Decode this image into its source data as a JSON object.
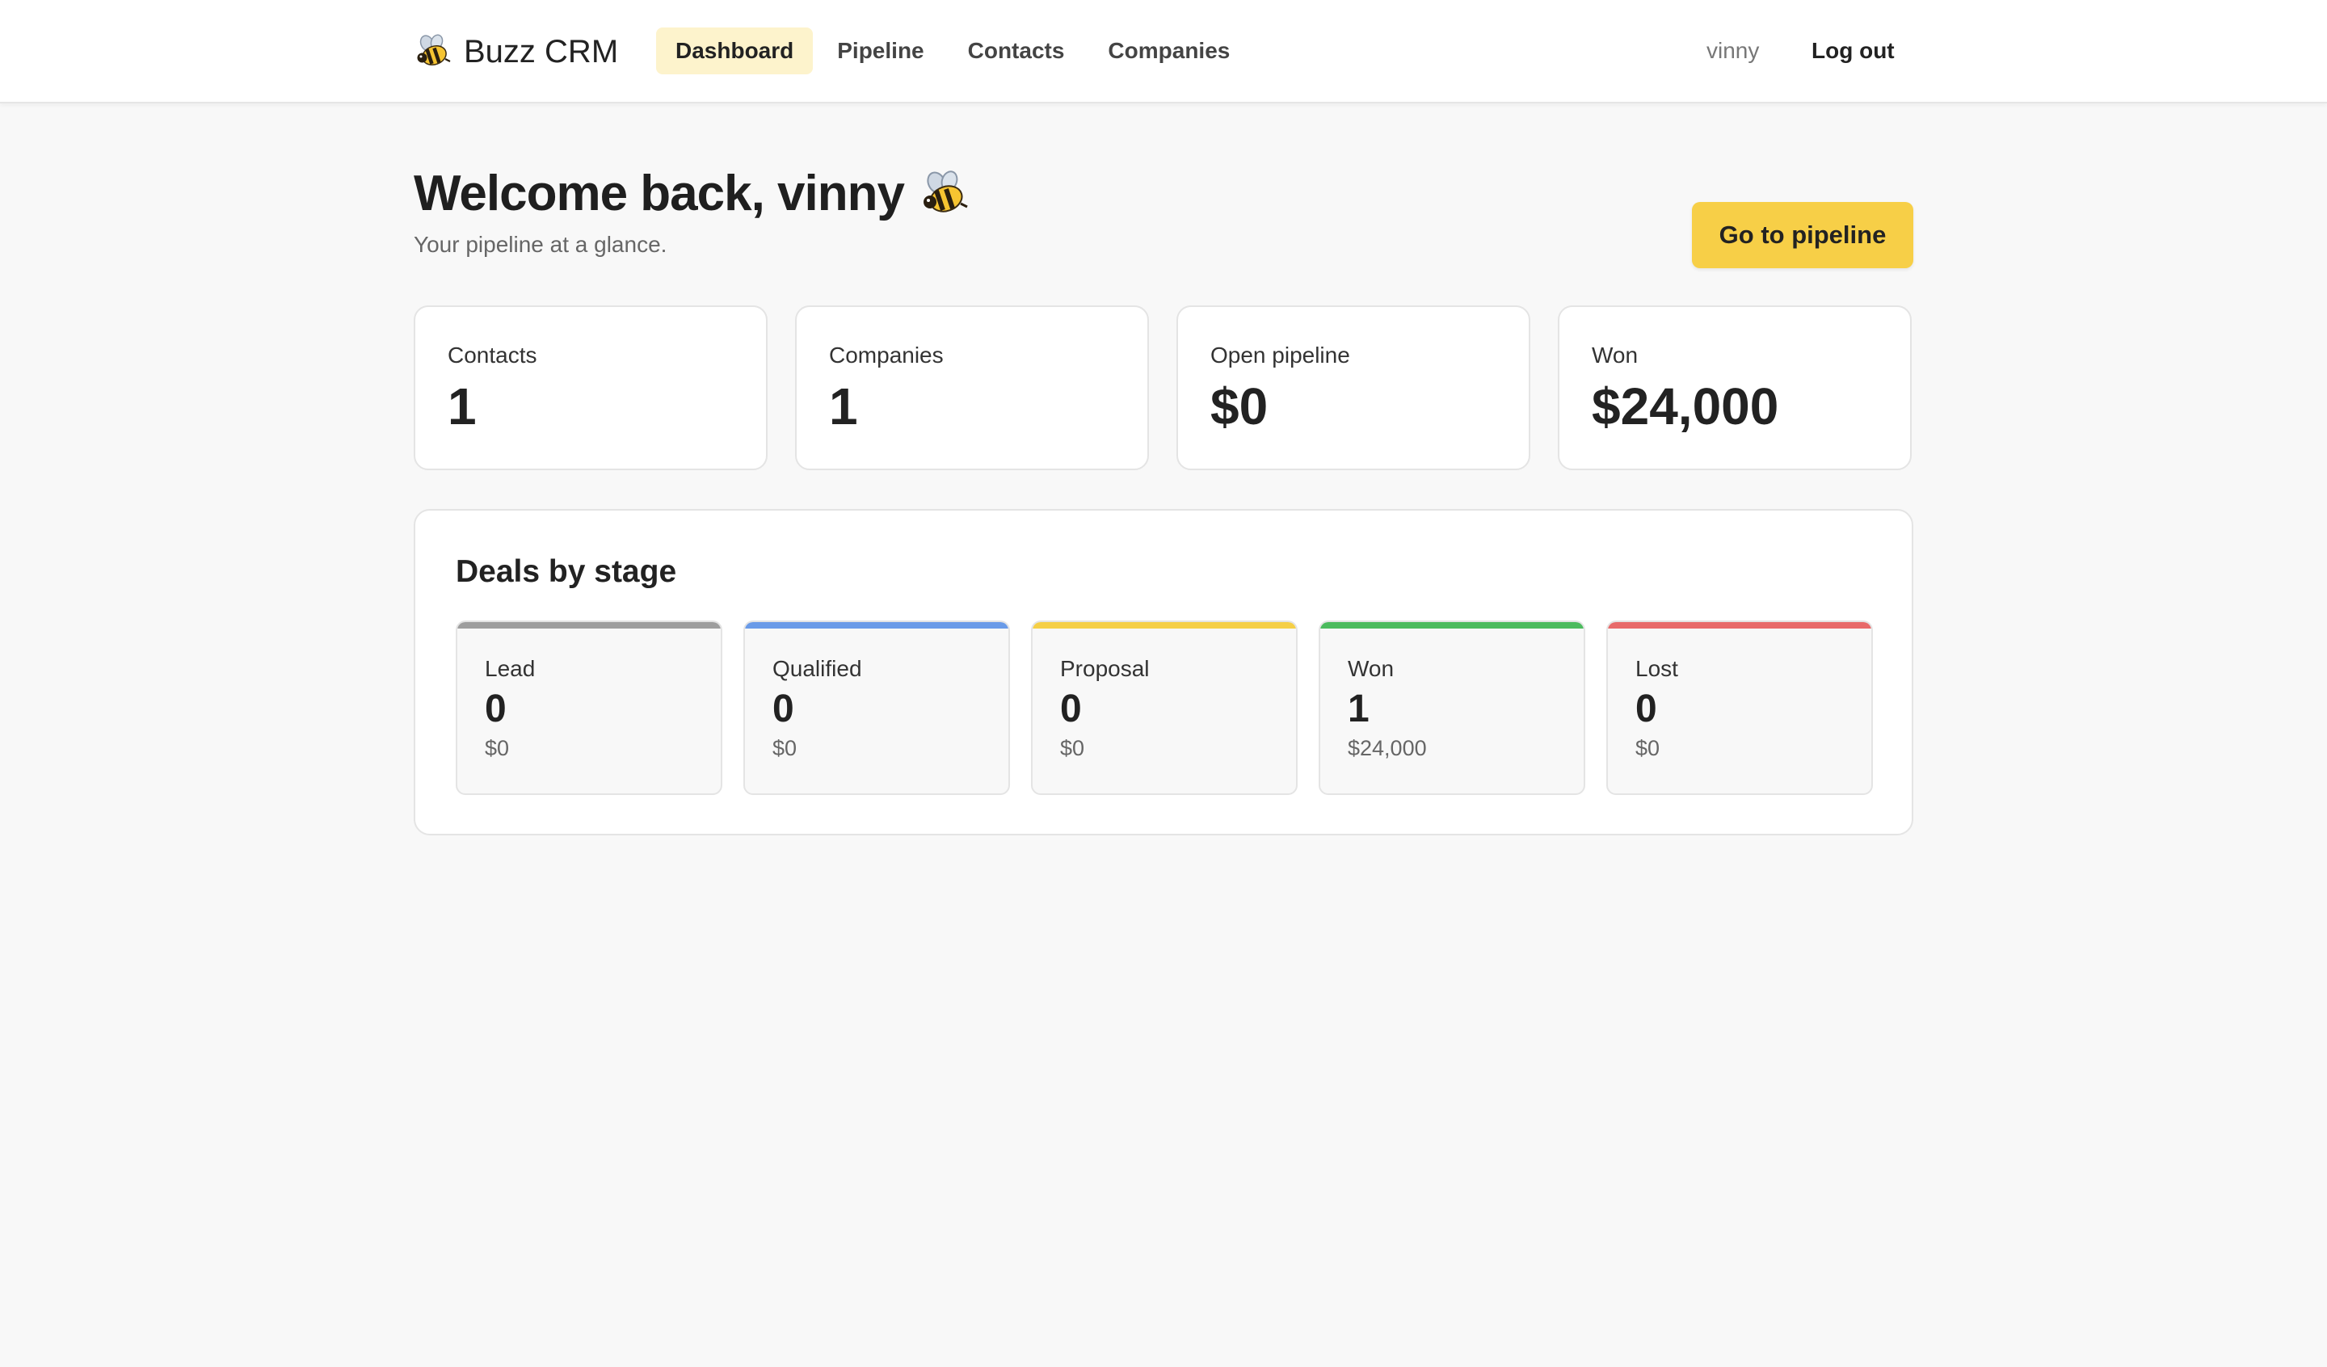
{
  "header": {
    "brand": "Buzz CRM",
    "brand_icon": "bee-icon",
    "nav": [
      {
        "label": "Dashboard",
        "active": true
      },
      {
        "label": "Pipeline",
        "active": false
      },
      {
        "label": "Contacts",
        "active": false
      },
      {
        "label": "Companies",
        "active": false
      }
    ],
    "user": "vinny",
    "logout_label": "Log out"
  },
  "welcome": {
    "title": "Welcome back, vinny",
    "subtitle": "Your pipeline at a glance."
  },
  "cta_label": "Go to pipeline",
  "stats": [
    {
      "label": "Contacts",
      "value": "1"
    },
    {
      "label": "Companies",
      "value": "1"
    },
    {
      "label": "Open pipeline",
      "value": "$0"
    },
    {
      "label": "Won",
      "value": "$24,000"
    }
  ],
  "deals": {
    "title": "Deals by stage",
    "stages": [
      {
        "label": "Lead",
        "count": "0",
        "amount": "$0",
        "color": "#9e9e9e"
      },
      {
        "label": "Qualified",
        "count": "0",
        "amount": "$0",
        "color": "#6a9be8"
      },
      {
        "label": "Proposal",
        "count": "0",
        "amount": "$0",
        "color": "#f5cf47"
      },
      {
        "label": "Won",
        "count": "1",
        "amount": "$24,000",
        "color": "#4cbb5e"
      },
      {
        "label": "Lost",
        "count": "0",
        "amount": "$0",
        "color": "#e86a6a"
      }
    ]
  },
  "colors": {
    "accent": "#f7cf47",
    "nav_active_bg": "#fdf3cc"
  }
}
